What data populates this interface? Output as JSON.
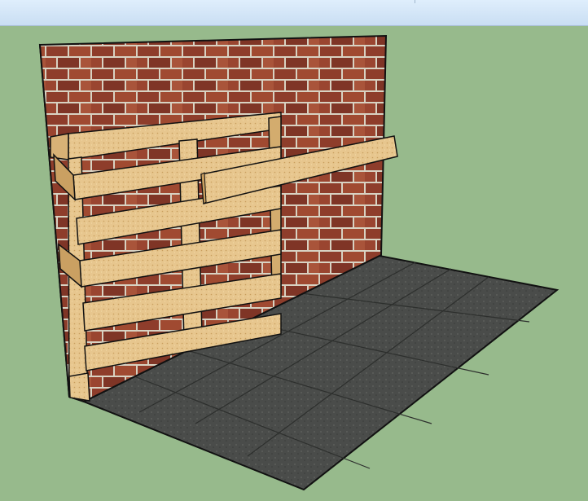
{
  "window": {
    "toolbar": {}
  },
  "viewport": {
    "background_color": "#97ba8c",
    "scene": {
      "objects": [
        "brick-wall",
        "pallet-planter",
        "wooden-shelf",
        "stone-tile-floor"
      ],
      "colors": {
        "brick": "#8e3d2b",
        "mortar": "#d8d2c2",
        "wood": "#e7c68e",
        "floor": "#4a4c4a"
      }
    }
  }
}
